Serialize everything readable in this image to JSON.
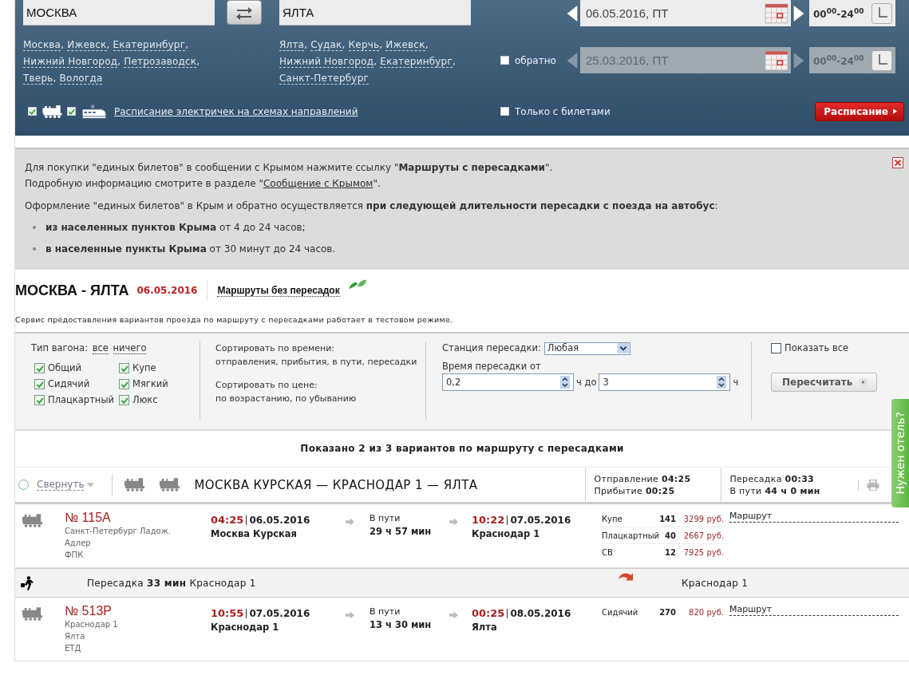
{
  "search": {
    "from": {
      "value": "МОСКВА"
    },
    "to": {
      "value": "ЯЛТА"
    },
    "separator": ", ",
    "from_suggestions": [
      "Москва",
      "Ижевск",
      "Екатеринбург",
      "Нижний Новгород",
      "Петрозаводск",
      "Тверь",
      "Вологда"
    ],
    "to_suggestions": [
      "Ялта",
      "Судак",
      "Керчь",
      "Ижевск",
      "Нижний Новгород",
      "Екатеринбург",
      "Санкт-Петербург"
    ],
    "dates": [
      {
        "value": "06.05.2016, ПТ",
        "time": "00$^{00}$-24$^{00}$",
        "disabled": false
      },
      {
        "label": "обратно",
        "checked": false,
        "value": "25.03.2016, ПТ",
        "time": "00$^{00}$-24$^{00}$",
        "disabled": true
      }
    ],
    "train_types": [
      {
        "kind": "train",
        "checked": true
      },
      {
        "kind": "electric",
        "checked": true
      }
    ],
    "schedule_link": "Расписание электричек на схемах направлений",
    "tickets_only": {
      "label": "Только с билетами",
      "checked": false
    },
    "submit": "Расписание"
  },
  "notice": {
    "lines": [
      "Для покупки \"единых билетов\" в сообщении с Крымом нажмите ссылку \"**Маршруты с пересадками**\"."
    ],
    "link_line": {
      "before": "Подробную информацию смотрите в разделе \"",
      "link": "Сообщение с Крымом",
      "after": "\"."
    },
    "intro": "Оформление \"единых билетов\" в Крым и обратно осуществляется **при следующей длительности пересадки с поезда на автобус**:",
    "bullets": [
      "**из населенных пунктов Крыма** от 4 до 24 часов;",
      "**в населенные пункты Крыма** от 30 минут до 24 часов."
    ]
  },
  "title": {
    "route": "МОСКВА - ЯЛТА",
    "date": "06.05.2016",
    "direct_link": "Маршруты без пересадок",
    "note": "Сервис предоставления вариантов проезда по маршруту с пересадками работает в тестовом режиме."
  },
  "filters": {
    "car_type_label": "Тип вагона:",
    "select_all": "все",
    "select_none": "ничего",
    "car_types": [
      {
        "label": "Общий",
        "checked": true
      },
      {
        "label": "Купе",
        "checked": true
      },
      {
        "label": "Сидячий",
        "checked": true
      },
      {
        "label": "Мягкий",
        "checked": true
      },
      {
        "label": "Плацкартный",
        "checked": true
      },
      {
        "label": "Люкс",
        "checked": true
      }
    ],
    "sort_time_label": "Сортировать по времени:",
    "sort_time": "отправления, прибытия, в пути, пересадки",
    "sort_price_label": "Сортировать по цене:",
    "sort_price": "по возрастанию, по убыванию",
    "station_label": "Станция пересадки:",
    "station": "Любая",
    "time_label": "Время пересадки от",
    "time_from": "0,2",
    "time_mid": "ч до",
    "time_to": "3",
    "time_unit": "ч",
    "show_all": {
      "label": "Показать все",
      "checked": false
    },
    "recalc": "Пересчитать"
  },
  "summary": "Показано 2 из 3 вариантов по маршруту с пересадками",
  "route": {
    "selected": false,
    "collapse": "Свернуть",
    "title": "МОСКВА КУРСКАЯ — КРАСНОДАР 1 — ЯЛТА",
    "departure": "Отправление **04:25**",
    "arrival": "Прибытие **00:25**",
    "transfer": "Пересадка **00:33**",
    "duration": "В пути **44 ч 0 мин**",
    "segments": [
      {
        "kind": "train",
        "number": "№ 115А",
        "info": [
          "Санкт-Петербург Ладож.",
          "Адлер",
          "ФПК"
        ],
        "dep_time": "04:25",
        "dep_date": "06.05.2016",
        "dep_station": "Москва Курская",
        "dur_label": "В пути",
        "duration": "29 ч 57 мин",
        "arr_time": "10:22",
        "arr_date": "07.05.2016",
        "arr_station": "Краснодар 1",
        "seats": [
          {
            "class": "Купе",
            "count": "141",
            "price": "3299 руб."
          },
          {
            "class": "Плацкартный",
            "count": "40",
            "price": "2667 руб."
          },
          {
            "class": "СВ",
            "count": "12",
            "price": "7925 руб."
          }
        ],
        "link": "Маршрут"
      },
      {
        "kind": "transfer",
        "text": "Пересадка **33 мин** Краснодар 1",
        "station": "Краснодар 1"
      },
      {
        "kind": "train",
        "number": "№ 513Р",
        "info": [
          "Краснодар 1",
          "Ялта",
          "ЕТД"
        ],
        "dep_time": "10:55",
        "dep_date": "07.05.2016",
        "dep_station": "Краснодар 1",
        "dur_label": "В пути",
        "duration": "13 ч 30 мин",
        "arr_time": "00:25",
        "arr_date": "08.05.2016",
        "arr_station": "Ялта",
        "seats": [
          {
            "class": "Сидячий",
            "count": "270",
            "price": "820 руб."
          }
        ],
        "link": "Маршрут"
      }
    ]
  },
  "hotel_tab": "Нужен отель?"
}
